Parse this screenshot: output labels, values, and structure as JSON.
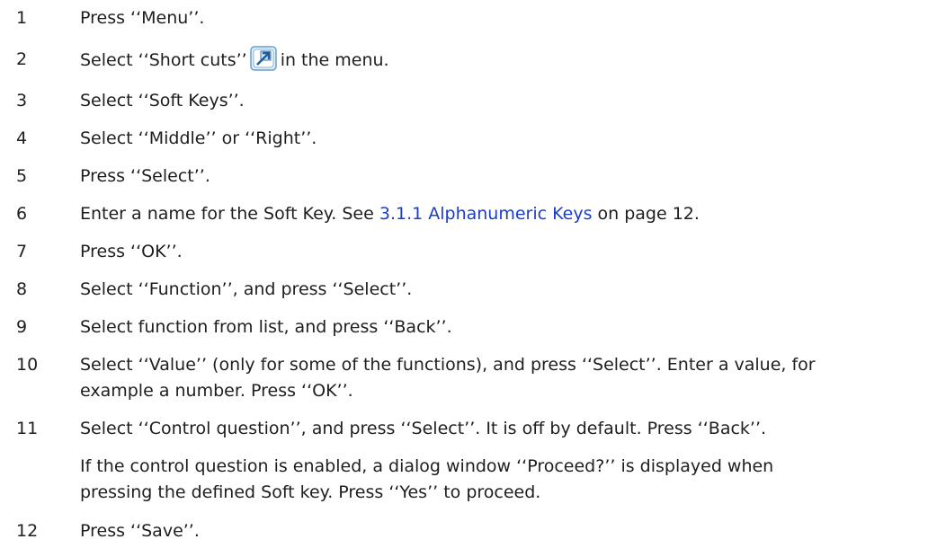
{
  "steps": [
    {
      "num": "1",
      "text": "Press ‘‘Menu’’."
    },
    {
      "num": "2",
      "before": "Select ‘‘Short cuts’’",
      "icon": "shortcut-icon",
      "after": "in the menu."
    },
    {
      "num": "3",
      "text": "Select ‘‘Soft Keys’’."
    },
    {
      "num": "4",
      "text": "Select ‘‘Middle’’ or ‘‘Right’’."
    },
    {
      "num": "5",
      "text": "Press ‘‘Select’’."
    },
    {
      "num": "6",
      "before": "Enter a name for the Soft Key. See ",
      "link": "3.1.1 Alphanumeric Keys",
      "after": " on page 12."
    },
    {
      "num": "7",
      "text": "Press ‘‘OK’’."
    },
    {
      "num": "8",
      "text": "Select ‘‘Function’’, and press ‘‘Select’’."
    },
    {
      "num": "9",
      "text": "Select function from list, and press ‘‘Back’’."
    },
    {
      "num": "10",
      "line1": "Select ‘‘Value’’ (only for some of the functions), and press ‘‘Select’’. Enter a value, for",
      "line2": "example a number. Press ‘‘OK’’."
    },
    {
      "num": "11",
      "line1": "Select ‘‘Control question’’, and press ‘‘Select’’. It is off by default. Press ‘‘Back’’.",
      "note1": "If the control question is enabled, a dialog window ‘‘Proceed?’’ is displayed when",
      "note2": "pressing the defined Soft key. Press ‘‘Yes’’ to proceed."
    },
    {
      "num": "12",
      "text": "Press ‘‘Save’’."
    }
  ]
}
